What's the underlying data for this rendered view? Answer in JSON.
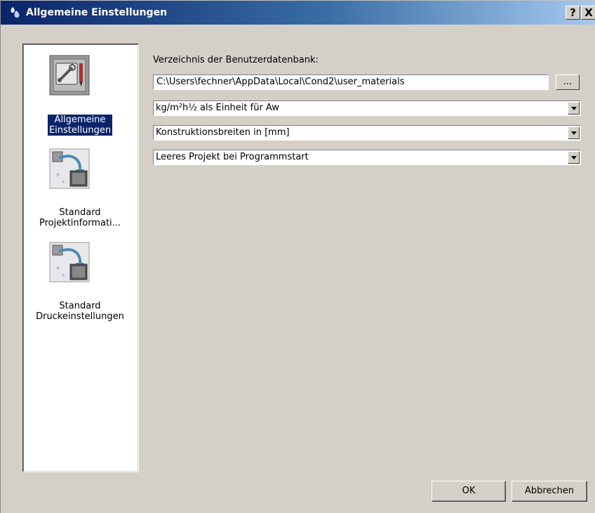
{
  "window": {
    "title": "Allgemeine Einstellungen",
    "help_label": "?",
    "close_label": "X"
  },
  "sidebar": {
    "items": [
      {
        "line1": "Allgemeine",
        "line2": "Einstellungen",
        "icon": "tools-icon",
        "selected": true
      },
      {
        "line1": "Standard",
        "line2": "Projektinformati...",
        "icon": "project-template-icon",
        "selected": false
      },
      {
        "line1": "Standard",
        "line2": "Druckeinstellungen",
        "icon": "print-template-icon",
        "selected": false
      }
    ]
  },
  "main": {
    "db_label": "Verzeichnis der Benutzerdatenbank:",
    "db_path": "C:\\Users\\fechner\\AppData\\Local\\Cond2\\user_materials",
    "browse_label": "...",
    "unit_aw": "kg/m²h½ als Einheit für Aw",
    "construction_width": "Konstruktionsbreiten in [mm]",
    "startup": "Leeres Projekt bei Programmstart"
  },
  "buttons": {
    "ok": "OK",
    "cancel": "Abbrechen"
  }
}
